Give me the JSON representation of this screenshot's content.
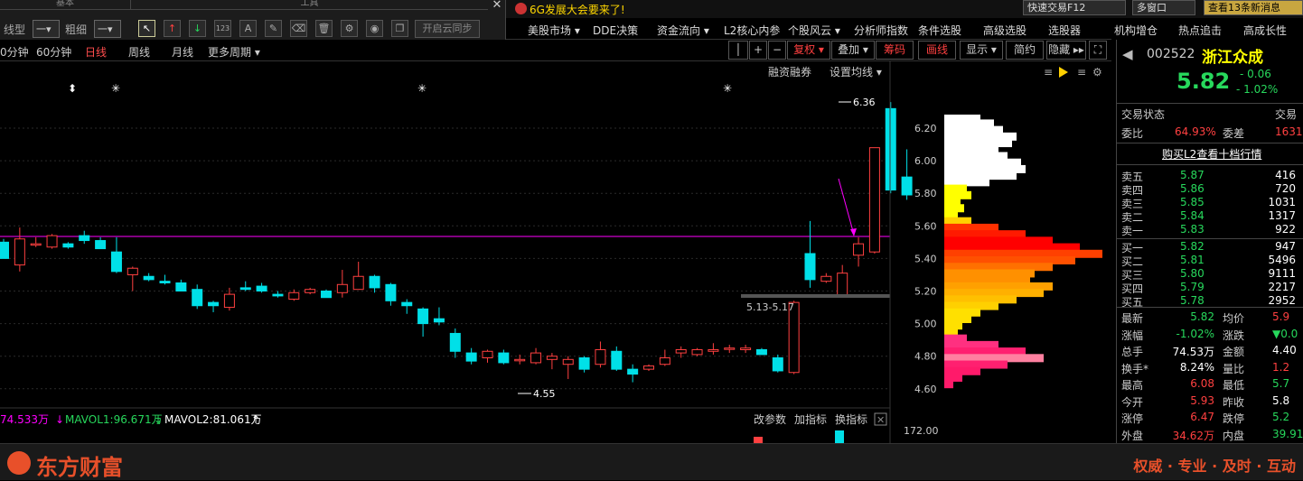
{
  "toolpanel": {
    "sec1": "基本",
    "sec2": "工具",
    "line_type_label": "线型",
    "line_type_value": "一▾",
    "thickness_label": "粗细",
    "thickness_value": "一▾",
    "sync_label": "开启云同步"
  },
  "topbar": {
    "news": "6G发展大会要来了!",
    "quick_trade": "快速交易F12",
    "multi_window": "多窗口",
    "msg": "查看13条新消息"
  },
  "menu": [
    "美股市场 ▾",
    "DDE决策",
    "资金流向 ▾",
    "L2核心内参",
    "个股风云 ▾",
    "分析师指数",
    "条件选股",
    "高级选股",
    "选股器",
    "机构增仓",
    "热点追击",
    "高成长性"
  ],
  "periods": {
    "p30": "0分钟",
    "p60": "60分钟",
    "day": "日线",
    "week": "周线",
    "month": "月线",
    "more": "更多周期 ▾"
  },
  "chart_btns": {
    "fuquan": "复权 ▾",
    "diejia": "叠加 ▾",
    "chouma": "筹码",
    "huaxian": "画线",
    "xianshi": "显示 ▾",
    "jianyue": "简约",
    "yincang": "隐藏 ▸▸"
  },
  "chart_top": {
    "rzrq": "融资融券",
    "set_ma": "设置均线 ▾"
  },
  "yaxis": [
    "6.20",
    "6.00",
    "5.80",
    "5.60",
    "5.40",
    "5.20",
    "5.00",
    "4.80",
    "4.60"
  ],
  "annotations": {
    "high": "6.36",
    "low": "4.55",
    "range": "5.13-5.17"
  },
  "vol": {
    "vol_label": "74.533万",
    "mavol1": "MAVOL1:96.671万",
    "mavol2": "MAVOL2:81.061万",
    "gcs": "改参数",
    "jzb": "加指标",
    "hzb": "换指标",
    "vmax": "172.00"
  },
  "stock": {
    "code": "002522",
    "name": "浙江众成",
    "price": "5.82",
    "change": "- 0.06",
    "change_pct": "- 1.02%"
  },
  "status": {
    "label": "交易状态",
    "label2": "交易",
    "wb_label": "委比",
    "wb_value": "64.93%",
    "wc_label": "委差",
    "wc_value": "1631",
    "l2": "购买L2查看十档行情"
  },
  "asks": [
    {
      "label": "卖五",
      "price": "5.87",
      "vol": "416"
    },
    {
      "label": "卖四",
      "price": "5.86",
      "vol": "720"
    },
    {
      "label": "卖三",
      "price": "5.85",
      "vol": "1031"
    },
    {
      "label": "卖二",
      "price": "5.84",
      "vol": "1317"
    },
    {
      "label": "卖一",
      "price": "5.83",
      "vol": "922"
    }
  ],
  "bids": [
    {
      "label": "买一",
      "price": "5.82",
      "vol": "947"
    },
    {
      "label": "买二",
      "price": "5.81",
      "vol": "5496"
    },
    {
      "label": "买三",
      "price": "5.80",
      "vol": "9111"
    },
    {
      "label": "买四",
      "price": "5.79",
      "vol": "2217"
    },
    {
      "label": "买五",
      "price": "5.78",
      "vol": "2952"
    }
  ],
  "stats": [
    {
      "l1": "最新",
      "v1": "5.82",
      "c1": "green",
      "l2": "均价",
      "v2": "5.9",
      "c2": "red"
    },
    {
      "l1": "涨幅",
      "v1": "-1.02%",
      "c1": "green",
      "l2": "涨跌",
      "v2": "▼0.0",
      "c2": "green"
    },
    {
      "l1": "总手",
      "v1": "74.53万",
      "c1": "white",
      "l2": "金额",
      "v2": "4.40",
      "c2": "white"
    },
    {
      "l1": "换手*",
      "v1": "8.24%",
      "c1": "white",
      "l2": "量比",
      "v2": "1.2",
      "c2": "red"
    },
    {
      "l1": "最高",
      "v1": "6.08",
      "c1": "red",
      "l2": "最低",
      "v2": "5.7",
      "c2": "green"
    },
    {
      "l1": "今开",
      "v1": "5.93",
      "c1": "red",
      "l2": "昨收",
      "v2": "5.8",
      "c2": "white"
    },
    {
      "l1": "涨停",
      "v1": "6.47",
      "c1": "red",
      "l2": "跌停",
      "v2": "5.2",
      "c2": "green"
    },
    {
      "l1": "外盘",
      "v1": "34.62万",
      "c1": "red",
      "l2": "内盘",
      "v2": "39.91",
      "c2": "green"
    }
  ],
  "footer": {
    "brand": "东方财富",
    "slogan": "权威 · 专业 · 及时 · 互动"
  },
  "colors": {
    "up": "#ff4040",
    "down": "#00e0e8",
    "ma": "#ff00ff"
  },
  "candles": [
    [
      5.5,
      5.4,
      5.52,
      5.4
    ],
    [
      5.36,
      5.52,
      5.59,
      5.32
    ],
    [
      5.49,
      5.49,
      5.53,
      5.47
    ],
    [
      5.47,
      5.54,
      5.55,
      5.46
    ],
    [
      5.49,
      5.47,
      5.5,
      5.46
    ],
    [
      5.54,
      5.51,
      5.57,
      5.49
    ],
    [
      5.51,
      5.46,
      5.53,
      5.46
    ],
    [
      5.44,
      5.32,
      5.53,
      5.31
    ],
    [
      5.3,
      5.34,
      5.35,
      5.2
    ],
    [
      5.29,
      5.27,
      5.31,
      5.26
    ],
    [
      5.26,
      5.25,
      5.3,
      5.24
    ],
    [
      5.25,
      5.2,
      5.27,
      5.2
    ],
    [
      5.21,
      5.11,
      5.24,
      5.09
    ],
    [
      5.13,
      5.11,
      5.14,
      5.07
    ],
    [
      5.1,
      5.18,
      5.22,
      5.08
    ],
    [
      5.22,
      5.21,
      5.26,
      5.2
    ],
    [
      5.23,
      5.2,
      5.25,
      5.19
    ],
    [
      5.18,
      5.17,
      5.2,
      5.16
    ],
    [
      5.15,
      5.19,
      5.21,
      5.14
    ],
    [
      5.19,
      5.21,
      5.22,
      5.18
    ],
    [
      5.2,
      5.16,
      5.21,
      5.16
    ],
    [
      5.19,
      5.24,
      5.33,
      5.16
    ],
    [
      5.21,
      5.29,
      5.38,
      5.21
    ],
    [
      5.29,
      5.22,
      5.3,
      5.19
    ],
    [
      5.24,
      5.14,
      5.25,
      5.11
    ],
    [
      5.13,
      5.11,
      5.15,
      5.06
    ],
    [
      5.09,
      5.0,
      5.1,
      4.92
    ],
    [
      5.03,
      5.01,
      5.1,
      4.99
    ],
    [
      4.94,
      4.83,
      4.97,
      4.79
    ],
    [
      4.82,
      4.77,
      4.85,
      4.75
    ],
    [
      4.79,
      4.83,
      4.84,
      4.76
    ],
    [
      4.82,
      4.76,
      4.84,
      4.75
    ],
    [
      4.78,
      4.78,
      4.81,
      4.75
    ],
    [
      4.76,
      4.82,
      4.85,
      4.75
    ],
    [
      4.78,
      4.8,
      4.82,
      4.72
    ],
    [
      4.75,
      4.78,
      4.8,
      4.66
    ],
    [
      4.79,
      4.72,
      4.8,
      4.7
    ],
    [
      4.75,
      4.84,
      4.89,
      4.73
    ],
    [
      4.83,
      4.72,
      4.86,
      4.71
    ],
    [
      4.72,
      4.69,
      4.75,
      4.64
    ],
    [
      4.72,
      4.74,
      4.75,
      4.71
    ],
    [
      4.75,
      4.79,
      4.84,
      4.74
    ],
    [
      4.82,
      4.84,
      4.86,
      4.79
    ],
    [
      4.81,
      4.84,
      4.85,
      4.8
    ],
    [
      4.83,
      4.84,
      4.88,
      4.81
    ],
    [
      4.85,
      4.85,
      4.87,
      4.82
    ],
    [
      4.84,
      4.85,
      4.87,
      4.82
    ],
    [
      4.84,
      4.81,
      4.85,
      4.81
    ],
    [
      4.79,
      4.71,
      4.81,
      4.7
    ],
    [
      4.7,
      5.13,
      5.14,
      4.69
    ],
    [
      5.43,
      5.27,
      5.63,
      5.22
    ],
    [
      5.26,
      5.29,
      5.31,
      5.25
    ],
    [
      5.17,
      5.31,
      5.36,
      5.17
    ],
    [
      5.42,
      5.49,
      5.53,
      5.35
    ],
    [
      5.44,
      6.08,
      6.08,
      5.43
    ],
    [
      6.32,
      5.82,
      6.36,
      5.8
    ],
    [
      5.9,
      5.79,
      6.07,
      5.76
    ]
  ],
  "profile": [
    {
      "p": 6.25,
      "w": 40,
      "c": "#ffffff"
    },
    {
      "p": 6.22,
      "w": 55,
      "c": "#ffffff"
    },
    {
      "p": 6.18,
      "w": 65,
      "c": "#ffffff"
    },
    {
      "p": 6.14,
      "w": 80,
      "c": "#ffffff"
    },
    {
      "p": 6.1,
      "w": 75,
      "c": "#ffffff"
    },
    {
      "p": 6.06,
      "w": 60,
      "c": "#ffffff"
    },
    {
      "p": 6.02,
      "w": 70,
      "c": "#ffffff"
    },
    {
      "p": 5.98,
      "w": 85,
      "c": "#ffffff"
    },
    {
      "p": 5.94,
      "w": 90,
      "c": "#ffffff"
    },
    {
      "p": 5.9,
      "w": 80,
      "c": "#ffffff"
    },
    {
      "p": 5.86,
      "w": 50,
      "c": "#ffffff"
    },
    {
      "p": 5.82,
      "w": 25,
      "c": "#ffff00"
    },
    {
      "p": 5.78,
      "w": 30,
      "c": "#ffff00"
    },
    {
      "p": 5.74,
      "w": 18,
      "c": "#ffff00"
    },
    {
      "p": 5.7,
      "w": 22,
      "c": "#ffff00"
    },
    {
      "p": 5.66,
      "w": 15,
      "c": "#ffff00"
    },
    {
      "p": 5.62,
      "w": 30,
      "c": "#ffd000"
    },
    {
      "p": 5.58,
      "w": 60,
      "c": "#ff3000"
    },
    {
      "p": 5.54,
      "w": 90,
      "c": "#ff1a00"
    },
    {
      "p": 5.5,
      "w": 120,
      "c": "#ff0000"
    },
    {
      "p": 5.46,
      "w": 150,
      "c": "#ff0000"
    },
    {
      "p": 5.42,
      "w": 175,
      "c": "#ff4000"
    },
    {
      "p": 5.38,
      "w": 145,
      "c": "#ff5000"
    },
    {
      "p": 5.34,
      "w": 120,
      "c": "#ff7000"
    },
    {
      "p": 5.3,
      "w": 100,
      "c": "#ff9000"
    },
    {
      "p": 5.26,
      "w": 95,
      "c": "#ff9000"
    },
    {
      "p": 5.22,
      "w": 120,
      "c": "#ffa000"
    },
    {
      "p": 5.18,
      "w": 110,
      "c": "#ffb000"
    },
    {
      "p": 5.14,
      "w": 80,
      "c": "#ffc000"
    },
    {
      "p": 5.1,
      "w": 60,
      "c": "#ffd000"
    },
    {
      "p": 5.06,
      "w": 40,
      "c": "#ffe000"
    },
    {
      "p": 5.02,
      "w": 30,
      "c": "#ffe000"
    },
    {
      "p": 4.98,
      "w": 20,
      "c": "#ffe000"
    },
    {
      "p": 4.94,
      "w": 15,
      "c": "#ffe000"
    },
    {
      "p": 4.9,
      "w": 25,
      "c": "#ff3080"
    },
    {
      "p": 4.86,
      "w": 60,
      "c": "#ff3080"
    },
    {
      "p": 4.82,
      "w": 90,
      "c": "#ff2070"
    },
    {
      "p": 4.78,
      "w": 110,
      "c": "#ff80a0"
    },
    {
      "p": 4.74,
      "w": 70,
      "c": "#ff2070"
    },
    {
      "p": 4.7,
      "w": 40,
      "c": "#ff1a6a"
    },
    {
      "p": 4.66,
      "w": 20,
      "c": "#ff1a6a"
    },
    {
      "p": 4.62,
      "w": 10,
      "c": "#ff1a6a"
    }
  ]
}
